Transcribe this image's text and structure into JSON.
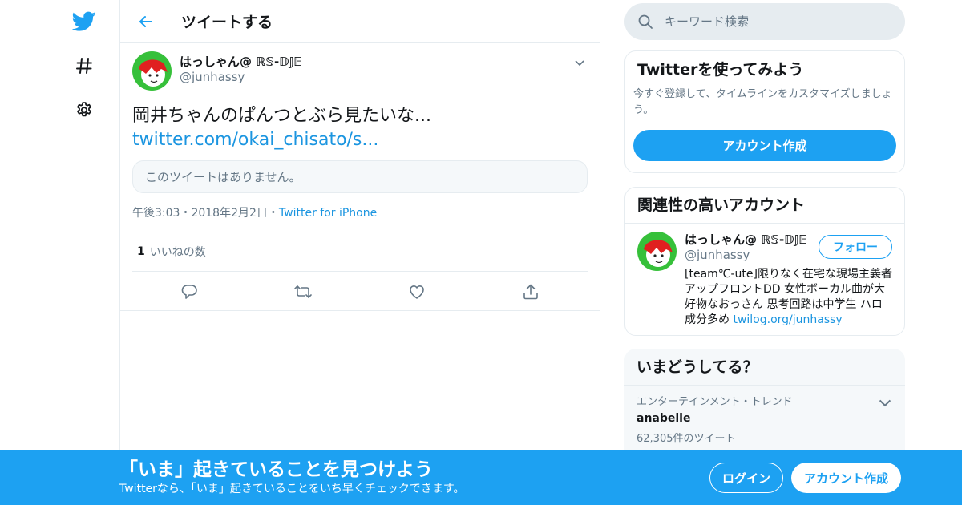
{
  "colors": {
    "accent": "#1da1f2",
    "link": "#1b95e0",
    "muted": "#657786",
    "border": "#e6ecf0"
  },
  "nav": {
    "icons": [
      "twitter-bird-icon",
      "hashtag-icon",
      "gear-icon"
    ]
  },
  "header": {
    "title": "ツイートする"
  },
  "tweet": {
    "author_name": "はっしゃん@ ℝ𝕊-𝔻𝕁𝔼",
    "author_handle": "@junhassy",
    "text": "岡井ちゃんのぱんつとぶら見たいな...",
    "link": "twitter.com/okai_chisato/s...",
    "quote_unavailable": "このツイートはありません。",
    "time": "午後3:03",
    "date": "2018年2月2日",
    "separator": "・",
    "source": "Twitter for iPhone",
    "like_count": "1",
    "like_label": "いいねの数"
  },
  "search": {
    "placeholder": "キーワード検索"
  },
  "signup_card": {
    "title": "Twitterを使ってみよう",
    "description": "今すぐ登録して、タイムラインをカスタマイズしましょう。",
    "button": "アカウント作成"
  },
  "related": {
    "title": "関連性の高いアカウント",
    "user": {
      "name": "はっしゃん@ ℝ𝕊-𝔻𝕁𝔼",
      "handle": "@junhassy",
      "bio": "[team℃-ute]限りなく在宅な現場主義者 アップフロントDD 女性ボーカル曲が大好物なおっさん 思考回路は中学生 ハロ成分多め ",
      "bio_link": "twilog.org/junhassy",
      "follow": "フォロー"
    }
  },
  "trends": {
    "title": "いまどうしてる？",
    "items": [
      {
        "category": "エンターテインメント・トレンド",
        "name": "anabelle",
        "count": "62,305件のツイート"
      }
    ]
  },
  "banner": {
    "title": "「いま」起きていることを見つけよう",
    "subtitle": "Twitterなら、「いま」起きていることをいち早くチェックできます。",
    "login": "ログイン",
    "signup": "アカウント作成"
  }
}
